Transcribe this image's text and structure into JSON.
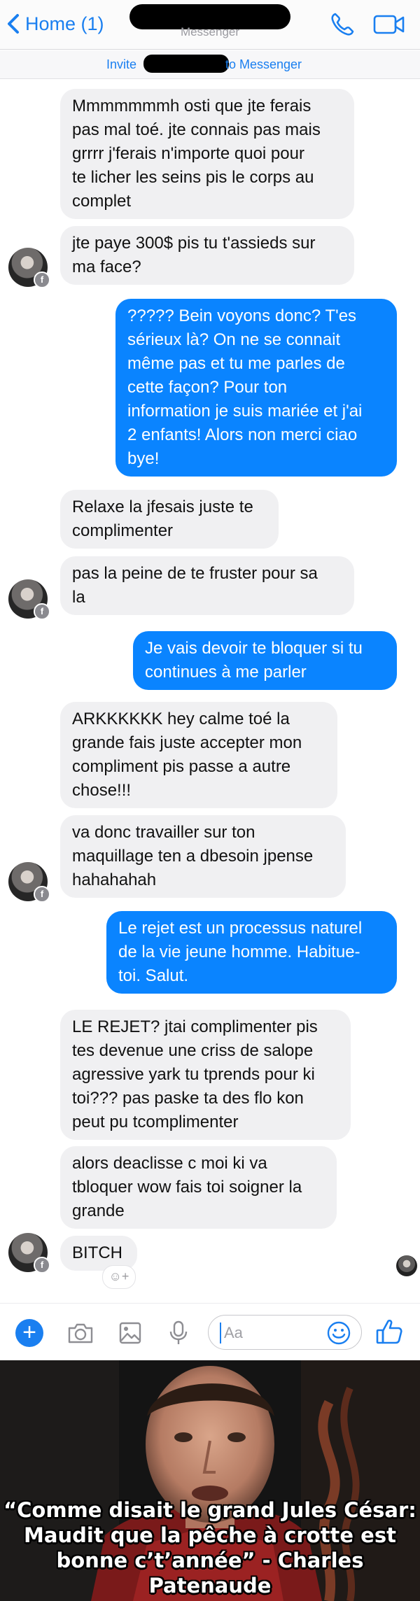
{
  "header": {
    "back_label": "Home (1)",
    "subtitle": "Messenger",
    "icons": [
      "chevron-left-icon",
      "phone-icon",
      "video-camera-icon"
    ]
  },
  "invite": {
    "prefix": "Invite",
    "suffix": "to Messenger"
  },
  "messages": [
    {
      "from": "them",
      "text": "Mmmmmmmh osti que jte ferais\npas mal toé. jte connais pas mais\ngrrrr j'ferais n'importe quoi pour\nte licher les seins pis le corps au\ncomplet"
    },
    {
      "from": "them",
      "text": "jte paye 300$ pis tu t'assieds sur\nma face?"
    },
    {
      "from": "me",
      "text": "????? Bein voyons donc? T'es\nsérieux là? On ne se connait\nmême pas et tu me parles de\ncette façon? Pour ton\ninformation je suis mariée et j'ai\n2 enfants! Alors non merci ciao\nbye!"
    },
    {
      "from": "them",
      "text": "Relaxe la jfesais juste te\ncomplimenter"
    },
    {
      "from": "them",
      "text": "pas la peine de te fruster pour sa\nla"
    },
    {
      "from": "me",
      "text": "Je vais devoir te bloquer si tu\ncontinues à me parler"
    },
    {
      "from": "them",
      "text": "ARKKKKKK hey calme toé la\ngrande fais juste accepter mon\ncompliment pis passe a autre\nchose!!!"
    },
    {
      "from": "them",
      "text": "va donc travailler sur ton\nmaquillage ten a dbesoin jpense\nhahahahah"
    },
    {
      "from": "me",
      "text": "Le rejet est un processus naturel\nde la vie jeune homme. Habitue-\ntoi. Salut."
    },
    {
      "from": "them",
      "text": "LE REJET? jtai complimenter pis\ntes devenue une criss de salope\nagressive yark tu tprends pour ki\ntoi??? pas paske ta des flo kon\npeut pu tcomplimenter"
    },
    {
      "from": "them",
      "text": "alors deaclisse c moi ki va\ntbloquer wow fais toi soigner la\ngrande"
    },
    {
      "from": "them",
      "text": "BITCH"
    }
  ],
  "composer": {
    "placeholder": "Aa",
    "icons": [
      "plus-icon",
      "camera-icon",
      "image-icon",
      "microphone-icon",
      "emoji-icon",
      "thumbs-up-icon"
    ]
  },
  "meme": {
    "caption": "“Comme disait le grand Jules César:\nMaudit que la pêche à crotte est\nbonne c’t’année” - Charles Patenaude"
  },
  "colors": {
    "accent": "#1a7ff0",
    "outgoing_bubble": "#0a84ff",
    "incoming_bubble": "#f0f0f2",
    "redaction": "#000000"
  }
}
